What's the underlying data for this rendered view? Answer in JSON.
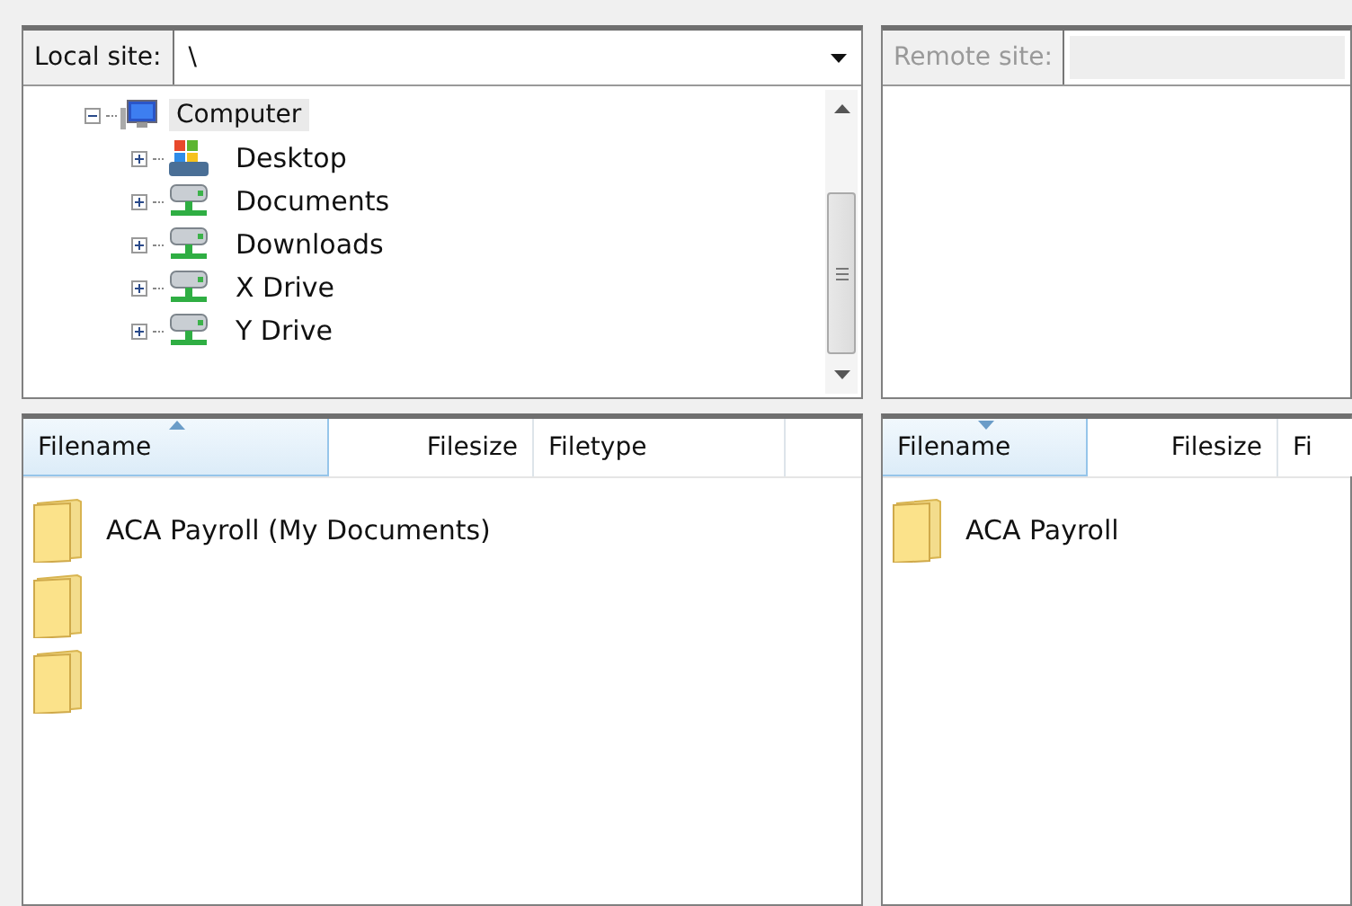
{
  "local_site": {
    "label": "Local site:",
    "value": "\\",
    "disabled": false
  },
  "local_tree": [
    {
      "label": "Computer",
      "kind": "computer",
      "expanded": true,
      "selected": true,
      "children": [
        {
          "label": "Desktop",
          "kind": "desktop",
          "expanded": false,
          "selected": false
        },
        {
          "label": "Documents",
          "kind": "drive",
          "expanded": false,
          "selected": false
        },
        {
          "label": "Downloads",
          "kind": "drive",
          "expanded": false,
          "selected": false
        },
        {
          "label": "X Drive",
          "kind": "drive",
          "expanded": false,
          "selected": false
        },
        {
          "label": "Y Drive",
          "kind": "drive",
          "expanded": false,
          "selected": false
        }
      ]
    }
  ],
  "remote_site": {
    "label": "Remote site:",
    "disabled": true
  },
  "local_files": {
    "columns": [
      {
        "label": "Filename",
        "sorted": true,
        "descending": false
      },
      {
        "label": "Filesize",
        "sorted": false,
        "descending": false
      },
      {
        "label": "Filetype",
        "sorted": false,
        "descending": false
      }
    ],
    "rows": [
      {
        "kind": "folder",
        "filename": "ACA Payroll (My Documents)"
      },
      {
        "kind": "folder"
      },
      {
        "kind": "folder"
      }
    ]
  },
  "remote_files": {
    "columns": [
      {
        "label": "Filename",
        "sorted": true,
        "descending": true
      },
      {
        "label": "Filesize",
        "sorted": false,
        "descending": false
      },
      {
        "label": "Fi",
        "sorted": false,
        "descending": false
      }
    ],
    "rows": [
      {
        "kind": "folder",
        "filename": "ACA Payroll"
      }
    ]
  }
}
